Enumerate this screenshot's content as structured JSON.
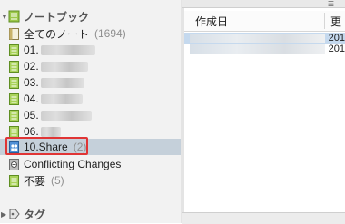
{
  "sidebar": {
    "notebooks_header": {
      "label": "ノートブック"
    },
    "items": [
      {
        "label": "全てのノート",
        "count": "(1694)",
        "icon": "all-notes-icon"
      },
      {
        "label": "01.",
        "count": "",
        "icon": "notebook-icon"
      },
      {
        "label": "02.",
        "count": "",
        "icon": "notebook-icon"
      },
      {
        "label": "03.",
        "count": "",
        "icon": "notebook-icon"
      },
      {
        "label": "04.",
        "count": "",
        "icon": "notebook-icon"
      },
      {
        "label": "05.",
        "count": "",
        "icon": "notebook-icon"
      },
      {
        "label": "06.",
        "count": "",
        "icon": "notebook-icon"
      },
      {
        "label": "10.Share",
        "count": "(2)",
        "icon": "shared-notebook-icon"
      },
      {
        "label": "Conflicting Changes",
        "count": "",
        "icon": "conflict-notebook-icon"
      },
      {
        "label": "不要",
        "count": "(5)",
        "icon": "notebook-icon"
      }
    ],
    "tags_header": {
      "label": "タグ"
    }
  },
  "note_list": {
    "columns": [
      "作成日",
      "更"
    ],
    "rows": [
      {
        "date": "201",
        "selected": true
      },
      {
        "date": "201",
        "selected": false
      }
    ]
  },
  "colors": {
    "selected_row": "#c5d0da",
    "highlight_border": "#e03535",
    "notebook_icon": "#8dbd3c"
  }
}
